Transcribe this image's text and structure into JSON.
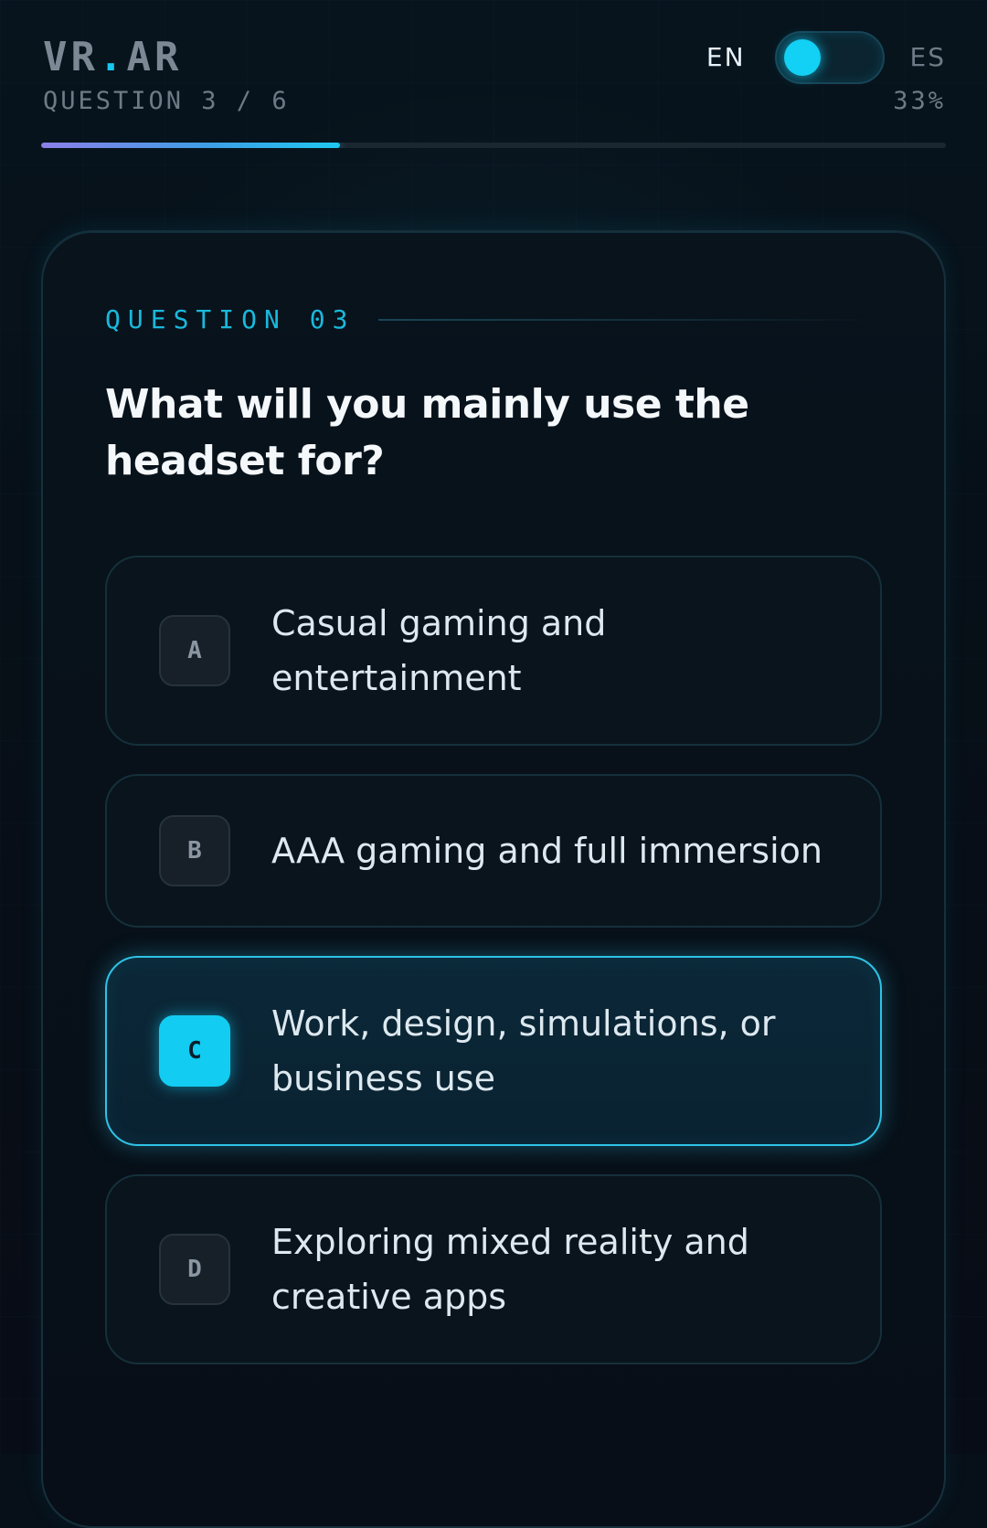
{
  "header": {
    "logo_prefix": "VR",
    "logo_dot": ".",
    "logo_suffix": "AR",
    "progress_label": "QUESTION 3 / 6",
    "percent_label": "33%",
    "progress_fraction": 0.33
  },
  "language": {
    "left_label": "EN",
    "right_label": "ES",
    "active": "EN"
  },
  "question": {
    "tag": "QUESTION 03",
    "text": "What will you mainly use the headset for?"
  },
  "options": [
    {
      "letter": "A",
      "label": "Casual gaming and entertainment",
      "selected": false
    },
    {
      "letter": "B",
      "label": "AAA gaming and full immersion",
      "selected": false
    },
    {
      "letter": "C",
      "label": "Work, design, simulations, or business use",
      "selected": true
    },
    {
      "letter": "D",
      "label": "Exploring mixed reality and creative apps",
      "selected": false
    }
  ],
  "colors": {
    "accent": "#13ccf1",
    "background": "#071019",
    "progress_gradient_start": "#8a7fe8"
  }
}
